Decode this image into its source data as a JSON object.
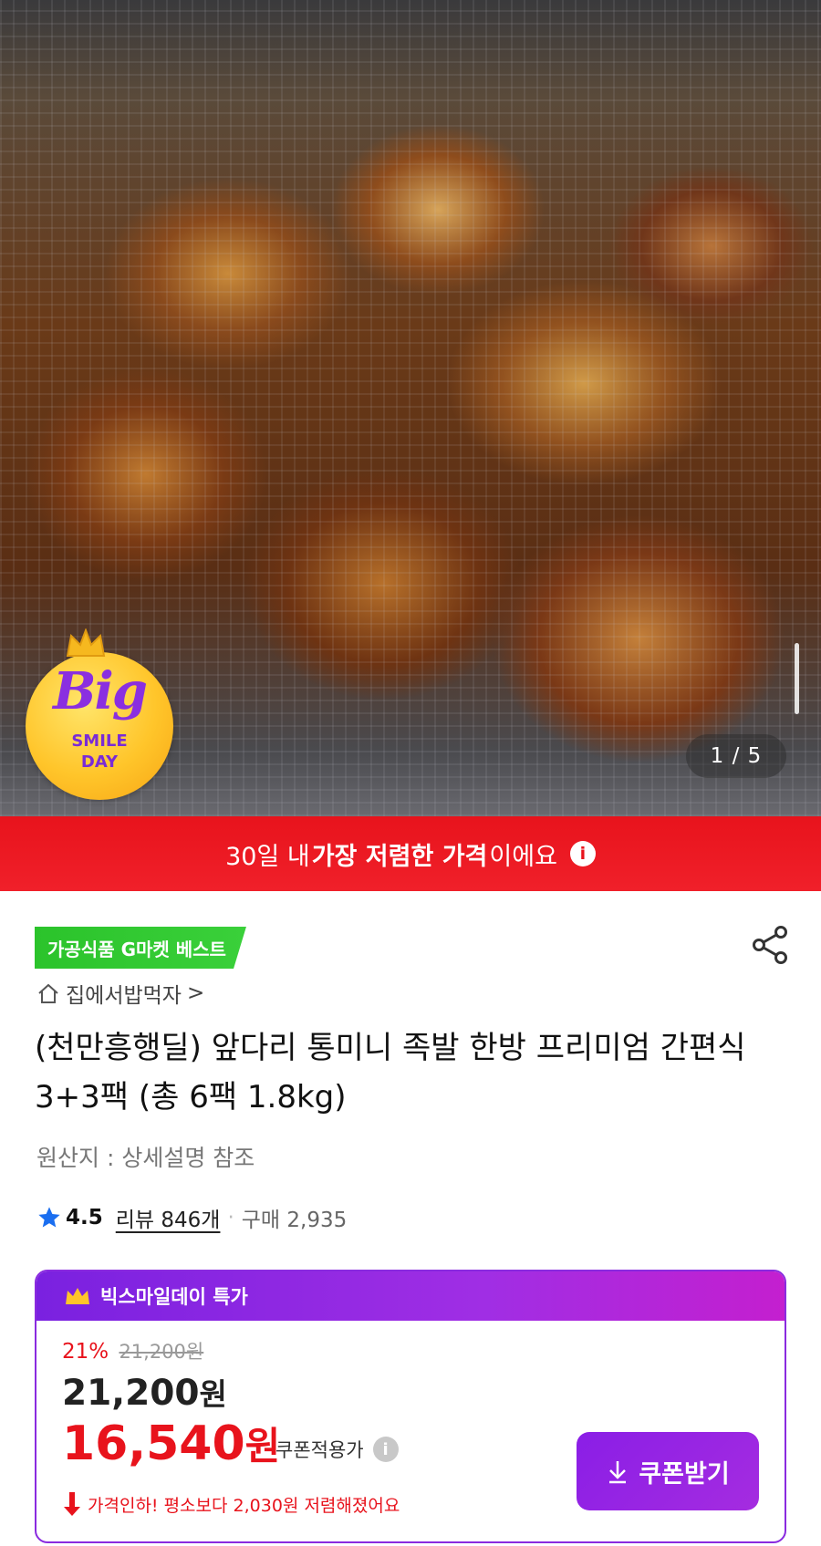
{
  "hero": {
    "counter": "1 / 5",
    "badge": {
      "big": "Big",
      "smile": "SMILE",
      "day": "DAY"
    }
  },
  "banner": {
    "text_pre": "30일 내 ",
    "text_bold": "가장 저렴한 가격",
    "text_post": "이에요",
    "info_glyph": "i"
  },
  "product": {
    "best_tag": "가공식품 G마켓 베스트",
    "store": "집에서밥먹자",
    "store_chevron": ">",
    "title": "(천만흥행딜) 앞다리 통미니 족발 한방 프리미엄 간편식 3+3팩 (총 6팩 1.8kg)",
    "origin": "원산지 : 상세설명 참조",
    "rating": "4.5",
    "reviews": "리뷰 846개",
    "separator": "·",
    "purchases": "구매 2,935"
  },
  "deal": {
    "header": "빅스마일데이 특가",
    "discount_pct": "21%",
    "original_price": "21,200원",
    "base_price_num": "21,200",
    "base_price_unit": "원",
    "coupon_price_num": "16,540",
    "coupon_price_unit": "원",
    "coupon_label": "쿠폰적용가",
    "info_glyph": "i",
    "drop_note": "가격인하! 평소보다 2,030원 저렴해졌어요",
    "coupon_button": "쿠폰받기"
  },
  "colors": {
    "banner_red": "#e8131c",
    "best_green": "#2bc32b",
    "deal_purple": "#8a2bdf",
    "price_red": "#e8131c"
  },
  "icons": [
    "crown-icon",
    "info-icon",
    "share-icon",
    "home-icon",
    "star-icon",
    "download-icon",
    "arrow-down-icon"
  ]
}
